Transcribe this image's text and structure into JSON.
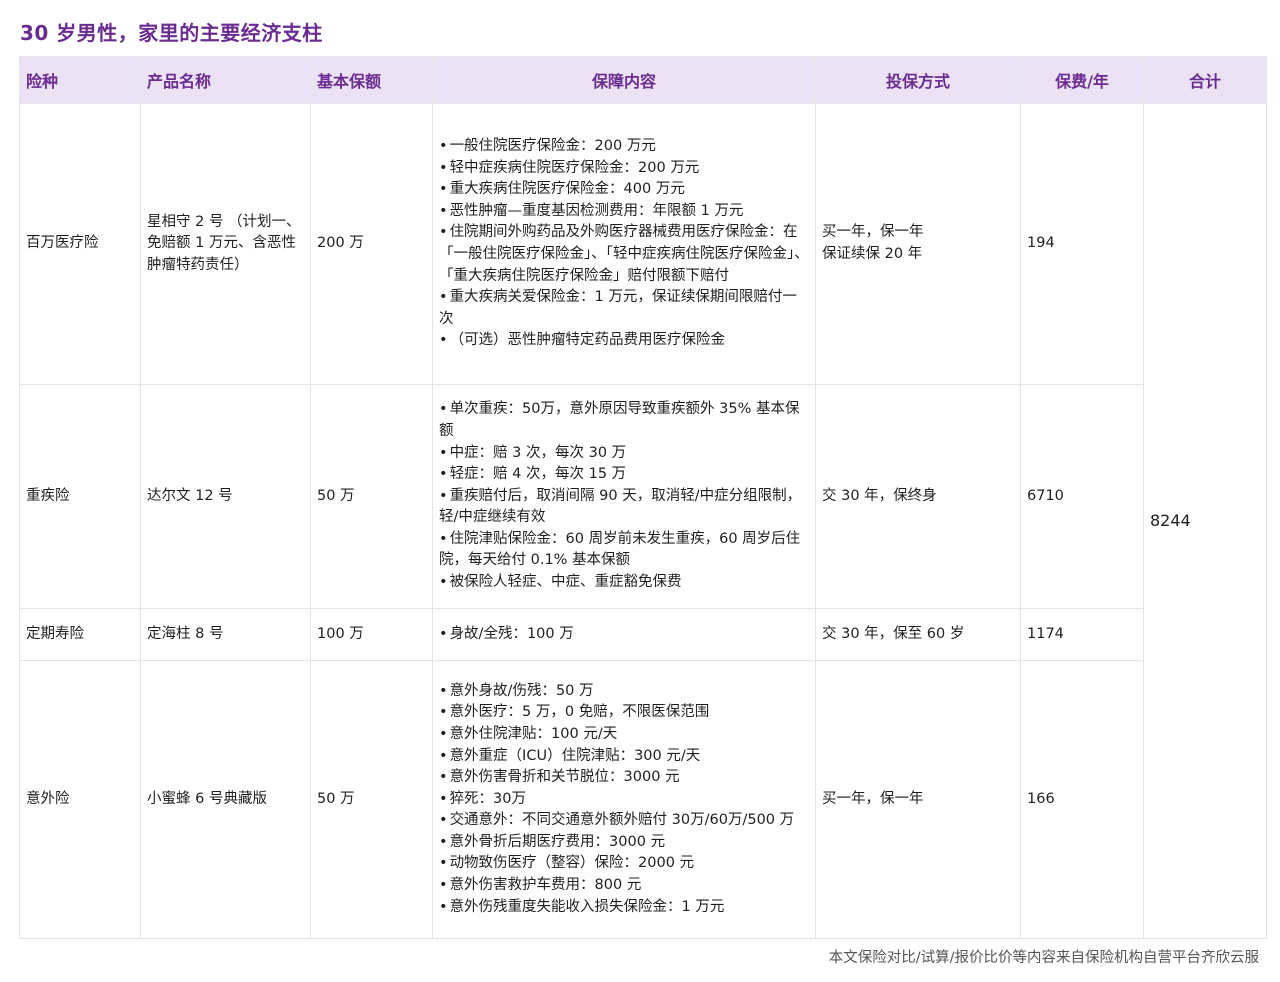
{
  "title": "30 岁男性，家里的主要经济支柱",
  "headers": [
    "险种",
    "产品名称",
    "基本保额",
    "保障内容",
    "投保方式",
    "保费/年",
    "合计"
  ],
  "rows": [
    {
      "type": "百万医疗险",
      "product": "星相守 2 号 （计划一、免赔额 1 万元、含恶性肿瘤特药责任）",
      "amount": "200 万",
      "coverage": [
        "一般住院医疗保险金：200 万元",
        "轻中症疾病住院医疗保险金：200 万元",
        "重大疾病住院医疗保险金：400 万元",
        "恶性肿瘤—重度基因检测费用：年限额 1 万元",
        "住院期间外购药品及外购医疗器械费用医疗保险金：在「一般住院医疗保险金」、「轻中症疾病住院医疗保险金」、「重大疾病住院医疗保险金」赔付限额下赔付",
        "重大疾病关爱保险金：1 万元，保证续保期间限赔付一次",
        "（可选）恶性肿瘤特定药品费用医疗保险金"
      ],
      "method_lines": [
        "买一年，保一年",
        "保证续保 20 年"
      ],
      "premium": "194"
    },
    {
      "type": "重疾险",
      "product": "达尔文 12 号",
      "amount": "50 万",
      "coverage": [
        "单次重疾：50万，意外原因导致重疾额外 35% 基本保额",
        "中症：赔 3 次，每次 30 万",
        "轻症：赔 4 次，每次 15 万",
        "重疾赔付后，取消间隔 90 天，取消轻/中症分组限制，轻/中症继续有效",
        "住院津贴保险金：60 周岁前未发生重疾，60 周岁后住院，每天给付 0.1% 基本保额",
        "被保险人轻症、中症、重症豁免保费"
      ],
      "method_lines": [
        "交 30 年，保终身"
      ],
      "premium": "6710"
    },
    {
      "type": "定期寿险",
      "product": "定海柱 8 号",
      "amount": "100 万",
      "coverage": [
        "身故/全残：100 万"
      ],
      "method_lines": [
        "交 30 年，保至 60 岁"
      ],
      "premium": "1174"
    },
    {
      "type": "意外险",
      "product": "小蜜蜂 6 号典藏版",
      "amount": "50 万",
      "coverage": [
        "意外身故/伤残：50 万",
        "意外医疗：5 万，0 免赔，不限医保范围",
        "意外住院津贴：100 元/天",
        "意外重症（ICU）住院津贴：300 元/天",
        "意外伤害骨折和关节脱位：3000 元",
        "猝死：30万",
        "交通意外：不同交通意外额外赔付 30万/60万/500 万",
        "意外骨折后期医疗费用：3000 元",
        "动物致伤医疗（整容）保险：2000 元",
        "意外伤害救护车费用：800 元",
        "意外伤残重度失能收入损失保险金：1 万元"
      ],
      "method_lines": [
        "买一年，保一年"
      ],
      "premium": "166"
    }
  ],
  "total": "8244",
  "bullet": "•",
  "footer": "本文保险对比/试算/报价比价等内容来自保险机构自营平台齐欣云服",
  "colors": {
    "title": "#6b2c91",
    "header_bg": "#ebe3f5",
    "header_text": "#6b2c91",
    "border": "#e4e4e4"
  }
}
